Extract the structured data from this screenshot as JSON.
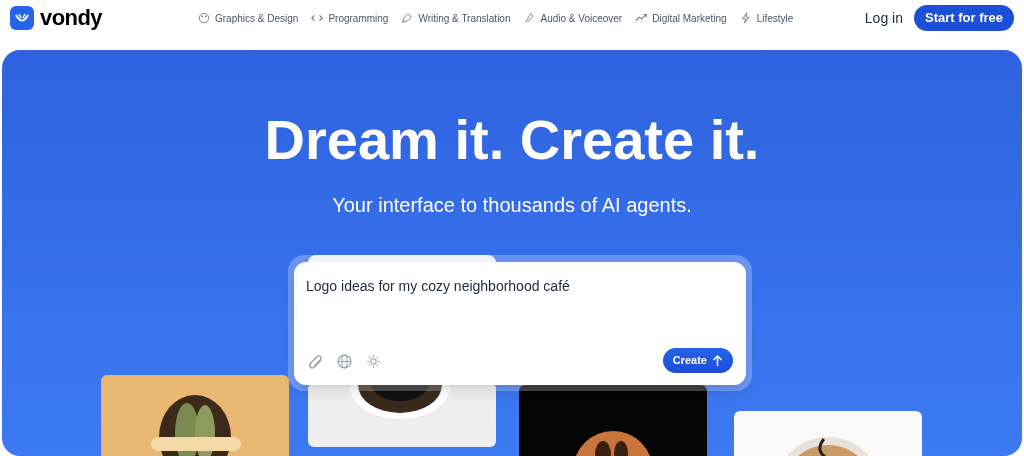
{
  "brand": {
    "name": "vondy"
  },
  "nav": [
    {
      "label": "Graphics & Design"
    },
    {
      "label": "Programming"
    },
    {
      "label": "Writing & Translation"
    },
    {
      "label": "Audio & Voiceover"
    },
    {
      "label": "Digital Marketing"
    },
    {
      "label": "Lifestyle"
    }
  ],
  "auth": {
    "login": "Log in",
    "signup": "Start for free"
  },
  "hero": {
    "title": "Dream it. Create it.",
    "subtitle": "Your interface to thousands of AI agents."
  },
  "prompt": {
    "value": "Logo ideas for my cozy neighborhood café",
    "submit": "Create"
  }
}
